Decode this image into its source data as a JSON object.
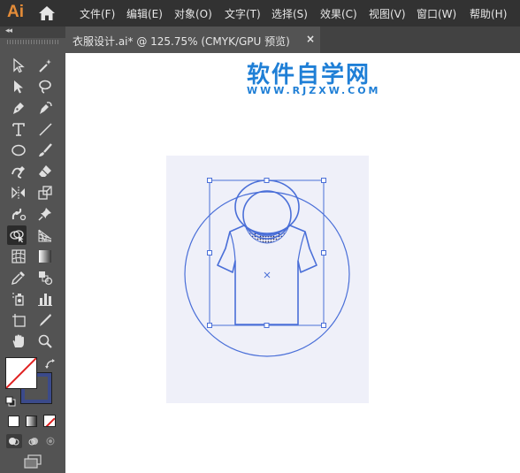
{
  "app": {
    "logo": "Ai",
    "home_icon": "home-icon"
  },
  "menu": {
    "items": [
      "文件(F)",
      "编辑(E)",
      "对象(O)",
      "文字(T)",
      "选择(S)",
      "效果(C)",
      "视图(V)",
      "窗口(W)",
      "帮助(H)"
    ]
  },
  "toolbar": {
    "collapse_label": "◂◂",
    "tools": [
      "selection-tool-icon",
      "magic-wand-icon",
      "direct-selection-icon",
      "lasso-icon",
      "pen-tool-icon",
      "curvature-tool-icon",
      "type-tool-icon",
      "line-segment-icon",
      "ellipse-tool-icon",
      "paintbrush-icon",
      "shaper-tool-icon",
      "eraser-icon",
      "reflect-tool-icon",
      "scale-tool-icon",
      "puppet-warp-icon",
      "pin-icon",
      "shape-builder-icon",
      "perspective-grid-icon",
      "mesh-tool-icon",
      "gradient-tool-icon",
      "eyedropper-icon",
      "blend-tool-icon",
      "symbol-sprayer-icon",
      "column-graph-icon",
      "artboard-tool-icon",
      "slice-tool-icon",
      "hand-tool-icon",
      "zoom-tool-icon"
    ],
    "fill_color": "#ffffff",
    "stroke_color": "#3b4a8a"
  },
  "document": {
    "tab_title": "衣服设计.ai* @ 125.75% (CMYK/GPU 预览)",
    "close_label": "×"
  },
  "watermark": {
    "title": "软件自学网",
    "url": "WWW.RJZXW.COM"
  },
  "colors": {
    "accent": "#e48c38",
    "artboard": "#eff0f9",
    "stroke": "#4a6fd8",
    "watermark": "#1f7fd6"
  }
}
